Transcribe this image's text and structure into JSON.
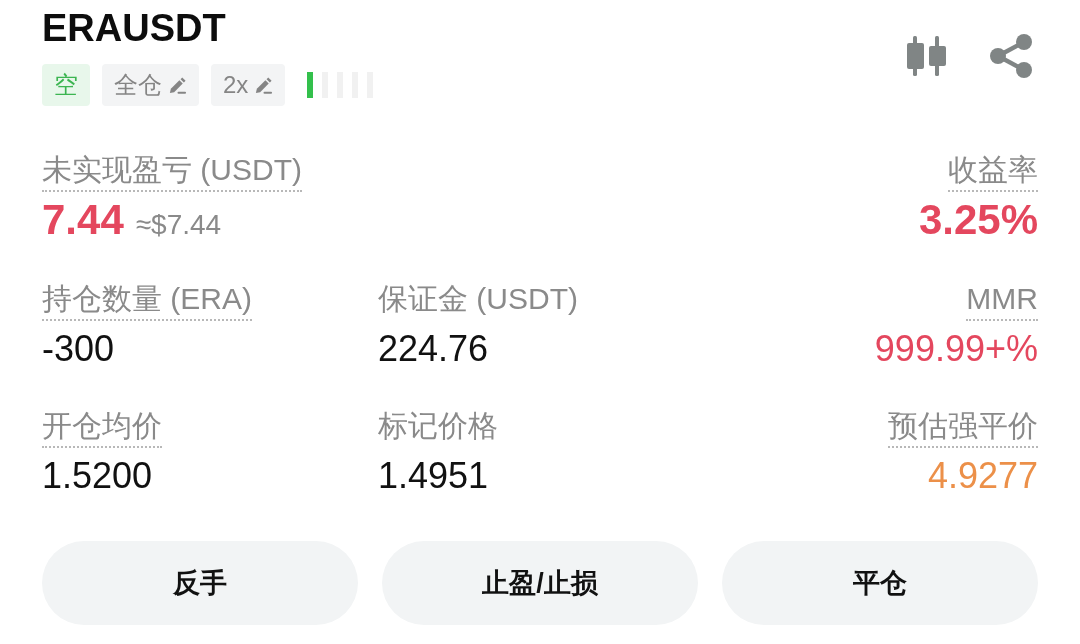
{
  "header": {
    "symbol": "ERAUSDT",
    "tags": [
      {
        "label": "空",
        "kind": "side"
      },
      {
        "label": "全仓",
        "kind": "editable"
      },
      {
        "label": "2x",
        "kind": "editable"
      }
    ],
    "risk_meter": {
      "level": 0.2
    }
  },
  "metric_rows": [
    {
      "cells": [
        {
          "label": "未实现盈亏 (USDT)",
          "tooltip": true,
          "value": "7.44",
          "approx": "≈$7.44",
          "color": "#e4475e"
        },
        {
          "label": "收益率",
          "tooltip": true,
          "value": "3.25%",
          "color": "#e4475e"
        }
      ]
    },
    {
      "cells": [
        {
          "label": "持仓数量 (ERA)",
          "tooltip": true,
          "value": "-300",
          "color": "#111111"
        },
        {
          "label": "保证金 (USDT)",
          "tooltip": false,
          "value": "224.76",
          "color": "#111111"
        },
        {
          "label": "MMR",
          "tooltip": true,
          "value": "999.99+%",
          "color": "#e4475e"
        }
      ]
    },
    {
      "cells": [
        {
          "label": "开仓均价",
          "tooltip": true,
          "value": "1.5200",
          "color": "#111111"
        },
        {
          "label": "标记价格",
          "tooltip": false,
          "value": "1.4951",
          "color": "#111111"
        },
        {
          "label": "预估强平价",
          "tooltip": true,
          "value": "4.9277",
          "color": "#ec9049"
        }
      ]
    }
  ],
  "actions": [
    "反手",
    "止盈/止损",
    "平仓"
  ]
}
